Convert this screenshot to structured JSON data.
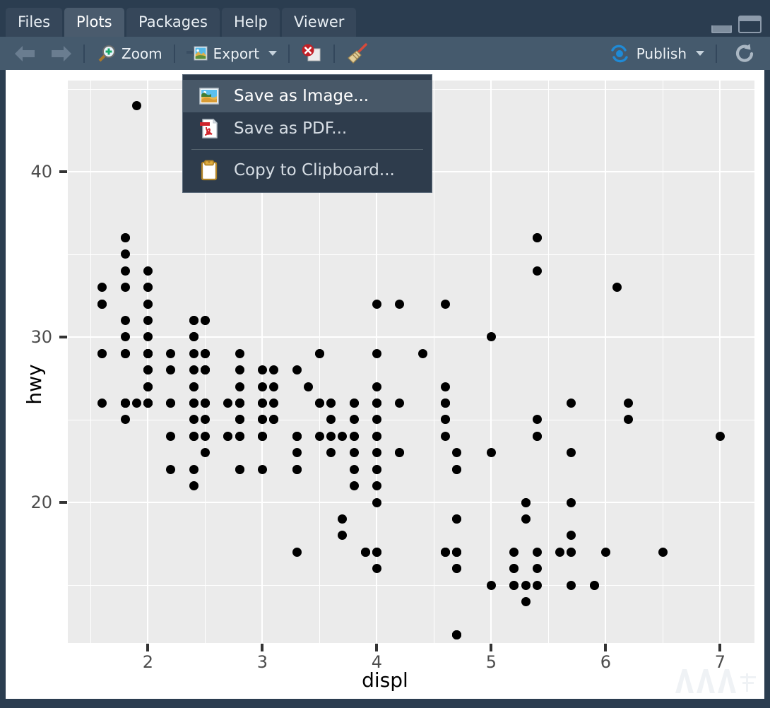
{
  "window": {
    "minimize_label": "minimize",
    "maximize_label": "maximize"
  },
  "tabs": [
    {
      "label": "Files",
      "active": false
    },
    {
      "label": "Plots",
      "active": true
    },
    {
      "label": "Packages",
      "active": false
    },
    {
      "label": "Help",
      "active": false
    },
    {
      "label": "Viewer",
      "active": false
    }
  ],
  "toolbar": {
    "back_label": "",
    "forward_label": "",
    "zoom_label": "Zoom",
    "export_label": "Export",
    "remove_label": "",
    "clear_all_label": "",
    "publish_label": "Publish",
    "refresh_label": ""
  },
  "export_menu": {
    "items": [
      {
        "label": "Save as Image...",
        "icon": "image-icon",
        "highlighted": true
      },
      {
        "label": "Save as PDF...",
        "icon": "pdf-icon",
        "highlighted": false
      },
      {
        "label": "Copy to Clipboard...",
        "icon": "clipboard-icon",
        "highlighted": false
      }
    ],
    "separator_after_index": 1
  },
  "watermark": {
    "text": "AAA"
  },
  "chart_data": {
    "type": "scatter",
    "title": "",
    "xlabel": "displ",
    "ylabel": "hwy",
    "xlim": [
      1.3,
      7.3
    ],
    "ylim": [
      11.5,
      45.5
    ],
    "xticks": [
      2,
      3,
      4,
      5,
      6,
      7
    ],
    "yticks": [
      20,
      30,
      40
    ],
    "x_minor_ticks": [
      1.5,
      2.5,
      3.5,
      4.5,
      5.5,
      6.5
    ],
    "y_minor_ticks": [
      15,
      25,
      35,
      45
    ],
    "grid": true,
    "legend": "none",
    "panel_background": "#ebebeb",
    "grid_color": "#ffffff",
    "point_color": "#000000",
    "points": [
      [
        1.8,
        29
      ],
      [
        1.8,
        29
      ],
      [
        2.0,
        31
      ],
      [
        2.0,
        30
      ],
      [
        2.8,
        26
      ],
      [
        2.8,
        26
      ],
      [
        3.1,
        27
      ],
      [
        1.8,
        26
      ],
      [
        1.8,
        25
      ],
      [
        2.0,
        28
      ],
      [
        2.0,
        27
      ],
      [
        2.8,
        25
      ],
      [
        2.8,
        25
      ],
      [
        3.1,
        25
      ],
      [
        3.1,
        25
      ],
      [
        2.8,
        24
      ],
      [
        3.1,
        25
      ],
      [
        4.2,
        23
      ],
      [
        5.3,
        20
      ],
      [
        5.3,
        15
      ],
      [
        5.3,
        20
      ],
      [
        5.7,
        17
      ],
      [
        6.0,
        17
      ],
      [
        5.7,
        26
      ],
      [
        5.7,
        23
      ],
      [
        6.2,
        26
      ],
      [
        6.2,
        25
      ],
      [
        7.0,
        24
      ],
      [
        5.3,
        19
      ],
      [
        5.3,
        14
      ],
      [
        5.7,
        15
      ],
      [
        6.5,
        17
      ],
      [
        2.4,
        27
      ],
      [
        2.4,
        30
      ],
      [
        3.1,
        26
      ],
      [
        3.5,
        29
      ],
      [
        3.6,
        26
      ],
      [
        2.4,
        24
      ],
      [
        3.0,
        24
      ],
      [
        3.3,
        22
      ],
      [
        3.3,
        22
      ],
      [
        3.3,
        24
      ],
      [
        3.3,
        24
      ],
      [
        3.3,
        17
      ],
      [
        3.8,
        22
      ],
      [
        3.8,
        21
      ],
      [
        3.8,
        23
      ],
      [
        4.0,
        23
      ],
      [
        3.7,
        19
      ],
      [
        3.7,
        18
      ],
      [
        3.9,
        17
      ],
      [
        3.9,
        17
      ],
      [
        4.7,
        19
      ],
      [
        4.7,
        19
      ],
      [
        4.7,
        12
      ],
      [
        5.2,
        17
      ],
      [
        5.2,
        15
      ],
      [
        3.9,
        17
      ],
      [
        4.7,
        17
      ],
      [
        4.7,
        12
      ],
      [
        4.7,
        17
      ],
      [
        5.2,
        16
      ],
      [
        5.7,
        18
      ],
      [
        5.9,
        15
      ],
      [
        4.7,
        16
      ],
      [
        4.7,
        12
      ],
      [
        4.7,
        17
      ],
      [
        4.7,
        17
      ],
      [
        4.7,
        16
      ],
      [
        4.7,
        12
      ],
      [
        5.2,
        15
      ],
      [
        5.2,
        16
      ],
      [
        5.7,
        17
      ],
      [
        5.9,
        15
      ],
      [
        4.6,
        17
      ],
      [
        5.4,
        16
      ],
      [
        5.4,
        15
      ],
      [
        4.0,
        17
      ],
      [
        4.0,
        17
      ],
      [
        4.0,
        17
      ],
      [
        4.0,
        16
      ],
      [
        4.6,
        17
      ],
      [
        5.0,
        15
      ],
      [
        4.2,
        26
      ],
      [
        4.2,
        23
      ],
      [
        4.6,
        26
      ],
      [
        4.6,
        26
      ],
      [
        4.6,
        26
      ],
      [
        5.4,
        25
      ],
      [
        5.4,
        24
      ],
      [
        3.8,
        24
      ],
      [
        3.8,
        24
      ],
      [
        4.0,
        22
      ],
      [
        4.0,
        20
      ],
      [
        4.6,
        17
      ],
      [
        4.6,
        17
      ],
      [
        5.4,
        17
      ],
      [
        1.6,
        33
      ],
      [
        1.6,
        32
      ],
      [
        1.6,
        32
      ],
      [
        1.6,
        29
      ],
      [
        1.6,
        32
      ],
      [
        1.8,
        34
      ],
      [
        1.8,
        36
      ],
      [
        1.8,
        36
      ],
      [
        2.0,
        29
      ],
      [
        2.4,
        26
      ],
      [
        2.4,
        27
      ],
      [
        2.4,
        30
      ],
      [
        2.4,
        31
      ],
      [
        2.5,
        26
      ],
      [
        2.5,
        26
      ],
      [
        3.3,
        28
      ],
      [
        2.0,
        26
      ],
      [
        2.0,
        29
      ],
      [
        2.0,
        28
      ],
      [
        2.0,
        27
      ],
      [
        2.7,
        24
      ],
      [
        2.7,
        24
      ],
      [
        2.7,
        26
      ],
      [
        3.0,
        25
      ],
      [
        3.7,
        24
      ],
      [
        4.0,
        21
      ],
      [
        4.7,
        22
      ],
      [
        4.7,
        23
      ],
      [
        4.7,
        22
      ],
      [
        5.7,
        20
      ],
      [
        6.1,
        33
      ],
      [
        4.0,
        32
      ],
      [
        4.2,
        32
      ],
      [
        4.4,
        29
      ],
      [
        4.6,
        32
      ],
      [
        5.4,
        34
      ],
      [
        5.4,
        36
      ],
      [
        5.4,
        36
      ],
      [
        4.0,
        29
      ],
      [
        4.0,
        26
      ],
      [
        4.6,
        27
      ],
      [
        5.0,
        30
      ],
      [
        2.4,
        31
      ],
      [
        2.4,
        26
      ],
      [
        2.5,
        26
      ],
      [
        2.5,
        28
      ],
      [
        3.5,
        26
      ],
      [
        3.5,
        29
      ],
      [
        3.0,
        28
      ],
      [
        3.0,
        27
      ],
      [
        3.5,
        24
      ],
      [
        3.3,
        24
      ],
      [
        3.3,
        24
      ],
      [
        4.0,
        22
      ],
      [
        5.6,
        17
      ],
      [
        3.1,
        28
      ],
      [
        3.8,
        25
      ],
      [
        3.8,
        26
      ],
      [
        3.8,
        26
      ],
      [
        4.0,
        24
      ],
      [
        4.0,
        27
      ],
      [
        4.6,
        25
      ],
      [
        4.6,
        25
      ],
      [
        5.4,
        24
      ],
      [
        1.6,
        29
      ],
      [
        1.6,
        26
      ],
      [
        1.8,
        26
      ],
      [
        1.8,
        26
      ],
      [
        1.8,
        31
      ],
      [
        2.0,
        33
      ],
      [
        2.4,
        24
      ],
      [
        2.4,
        24
      ],
      [
        2.4,
        29
      ],
      [
        2.4,
        30
      ],
      [
        2.5,
        31
      ],
      [
        2.5,
        28
      ],
      [
        3.4,
        27
      ],
      [
        3.4,
        44
      ],
      [
        3.4,
        41
      ],
      [
        2.0,
        29
      ],
      [
        2.0,
        26
      ],
      [
        2.0,
        28
      ],
      [
        2.0,
        29
      ],
      [
        2.8,
        29
      ],
      [
        1.9,
        44
      ],
      [
        2.0,
        29
      ],
      [
        2.0,
        29
      ],
      [
        2.0,
        29
      ],
      [
        2.0,
        29
      ],
      [
        2.5,
        28
      ],
      [
        2.5,
        29
      ],
      [
        2.8,
        26
      ],
      [
        2.8,
        26
      ],
      [
        1.9,
        26
      ],
      [
        2.0,
        26
      ],
      [
        2.0,
        26
      ],
      [
        2.0,
        26
      ],
      [
        2.5,
        25
      ],
      [
        2.5,
        26
      ],
      [
        2.8,
        24
      ],
      [
        2.8,
        24
      ],
      [
        3.6,
        24
      ],
      [
        1.8,
        26
      ],
      [
        1.8,
        26
      ],
      [
        1.8,
        26
      ],
      [
        1.8,
        26
      ],
      [
        2.0,
        29
      ],
      [
        2.0,
        29
      ],
      [
        2.2,
        28
      ],
      [
        2.2,
        29
      ],
      [
        2.4,
        31
      ],
      [
        2.4,
        28
      ],
      [
        2.5,
        29
      ],
      [
        2.5,
        29
      ],
      [
        2.5,
        28
      ],
      [
        2.5,
        31
      ],
      [
        2.8,
        26
      ],
      [
        3.0,
        26
      ],
      [
        3.0,
        26
      ],
      [
        3.3,
        23
      ],
      [
        1.8,
        33
      ],
      [
        1.8,
        35
      ],
      [
        2.0,
        32
      ],
      [
        2.0,
        34
      ],
      [
        2.8,
        27
      ],
      [
        2.8,
        28
      ],
      [
        3.6,
        26
      ],
      [
        3.6,
        25
      ],
      [
        2.0,
        27
      ],
      [
        2.5,
        23
      ],
      [
        2.5,
        24
      ],
      [
        2.8,
        22
      ],
      [
        2.8,
        22
      ],
      [
        4.0,
        26
      ],
      [
        4.0,
        26
      ],
      [
        4.0,
        24
      ],
      [
        4.0,
        25
      ],
      [
        4.6,
        24
      ],
      [
        5.0,
        23
      ],
      [
        2.2,
        22
      ],
      [
        2.2,
        24
      ],
      [
        2.4,
        22
      ],
      [
        2.4,
        21
      ],
      [
        3.0,
        24
      ],
      [
        3.0,
        22
      ],
      [
        3.5,
        26
      ],
      [
        2.2,
        26
      ],
      [
        2.2,
        26
      ],
      [
        2.4,
        25
      ],
      [
        2.4,
        26
      ],
      [
        3.0,
        24
      ],
      [
        3.0,
        25
      ],
      [
        3.3,
        22
      ],
      [
        1.8,
        29
      ],
      [
        1.8,
        30
      ],
      [
        2.0,
        32
      ],
      [
        2.0,
        33
      ],
      [
        2.8,
        25
      ],
      [
        2.8,
        26
      ],
      [
        3.6,
        23
      ]
    ]
  }
}
